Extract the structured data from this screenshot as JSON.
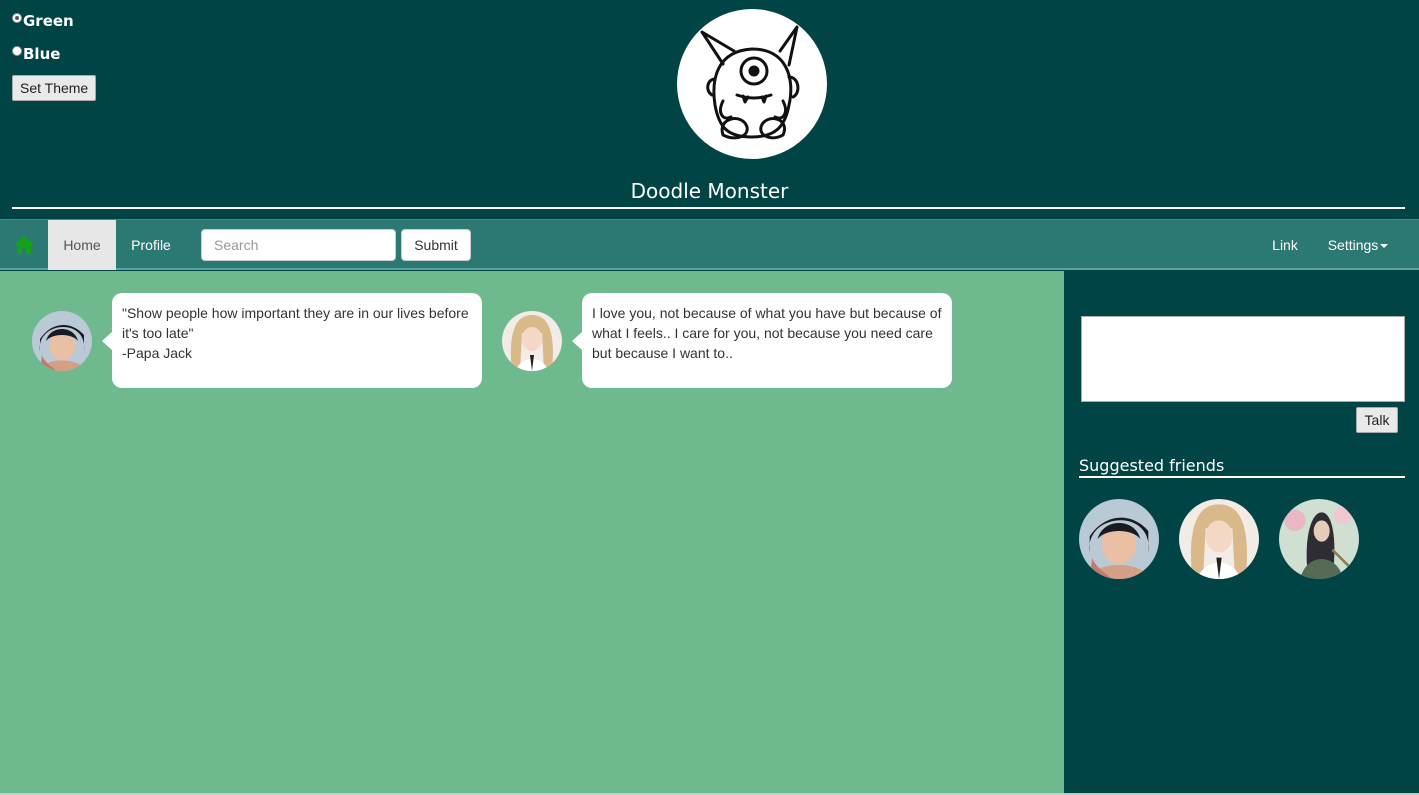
{
  "theme": {
    "options": [
      {
        "label": "Green",
        "checked": true
      },
      {
        "label": "Blue",
        "checked": false
      }
    ],
    "button_label": "Set Theme"
  },
  "header": {
    "logo_icon": "doodle-monster-logo",
    "title": "Doodle Monster"
  },
  "navbar": {
    "home_icon": "home-icon",
    "items": [
      {
        "label": "Home",
        "active": true
      },
      {
        "label": "Profile",
        "active": false
      }
    ],
    "search_placeholder": "Search",
    "submit_label": "Submit",
    "right_items": [
      {
        "label": "Link"
      },
      {
        "label": "Settings",
        "dropdown": true
      }
    ]
  },
  "feed": {
    "posts": [
      {
        "avatar": "dark-hair-girl-avatar",
        "text": "\"Show people how important they are in our lives before it's too late\"\n-Papa Jack"
      },
      {
        "avatar": "blonde-girl-avatar",
        "text": "I love you, not because of what you have but because of what I feels.. I care for you, not because you need care but because I want to.."
      }
    ]
  },
  "sidebar": {
    "textarea_value": "",
    "talk_label": "Talk",
    "suggested_title": "Suggested friends",
    "friends": [
      {
        "avatar": "dark-hair-girl-avatar"
      },
      {
        "avatar": "blonde-girl-avatar"
      },
      {
        "avatar": "warrior-girl-avatar"
      }
    ]
  },
  "colors": {
    "header_bg": "#004445",
    "navbar_bg": "#2c7873",
    "feed_bg": "#6fb98f",
    "sidebar_bg": "#004445",
    "home_icon": "#15a21b"
  }
}
